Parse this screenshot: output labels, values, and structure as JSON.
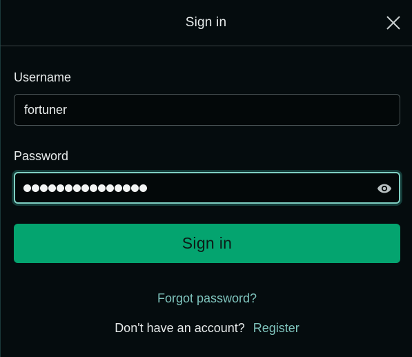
{
  "header": {
    "title": "Sign in",
    "close_icon": "close-icon"
  },
  "form": {
    "username": {
      "label": "Username",
      "value": "fortuner"
    },
    "password": {
      "label": "Password",
      "masked_length": 15,
      "toggle_icon": "eye-icon"
    },
    "submit_label": "Sign in"
  },
  "links": {
    "forgot": "Forgot password?",
    "no_account": "Don't have an account?",
    "register": "Register"
  },
  "colors": {
    "background": "#050c0e",
    "accent": "#04a46f",
    "link": "#7fc4bd",
    "focus_ring": "#7fcfc2"
  }
}
